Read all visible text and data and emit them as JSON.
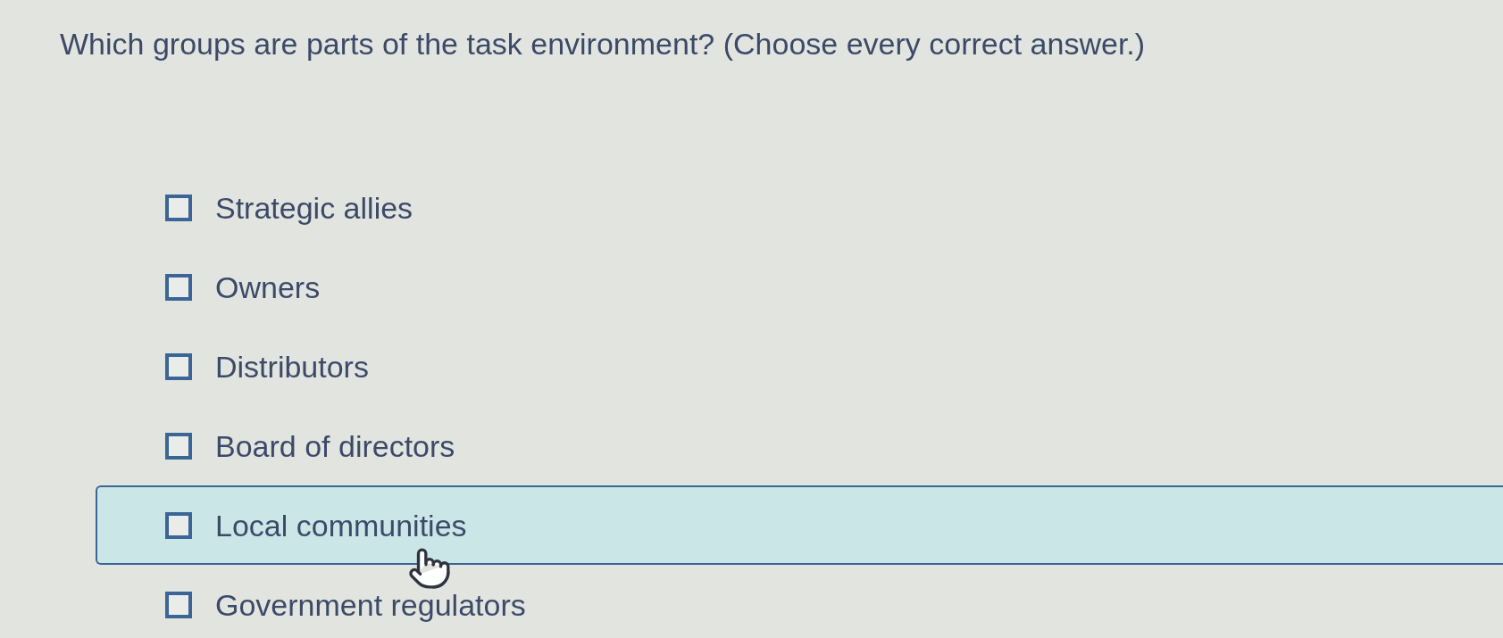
{
  "question": "Which groups are parts of the task environment? (Choose every correct answer.)",
  "options": [
    {
      "label": "Strategic allies",
      "checked": false,
      "highlighted": false
    },
    {
      "label": "Owners",
      "checked": false,
      "highlighted": false
    },
    {
      "label": "Distributors",
      "checked": false,
      "highlighted": false
    },
    {
      "label": "Board of directors",
      "checked": false,
      "highlighted": false
    },
    {
      "label": "Local communities",
      "checked": false,
      "highlighted": true
    },
    {
      "label": "Government regulators",
      "checked": false,
      "highlighted": false
    }
  ]
}
